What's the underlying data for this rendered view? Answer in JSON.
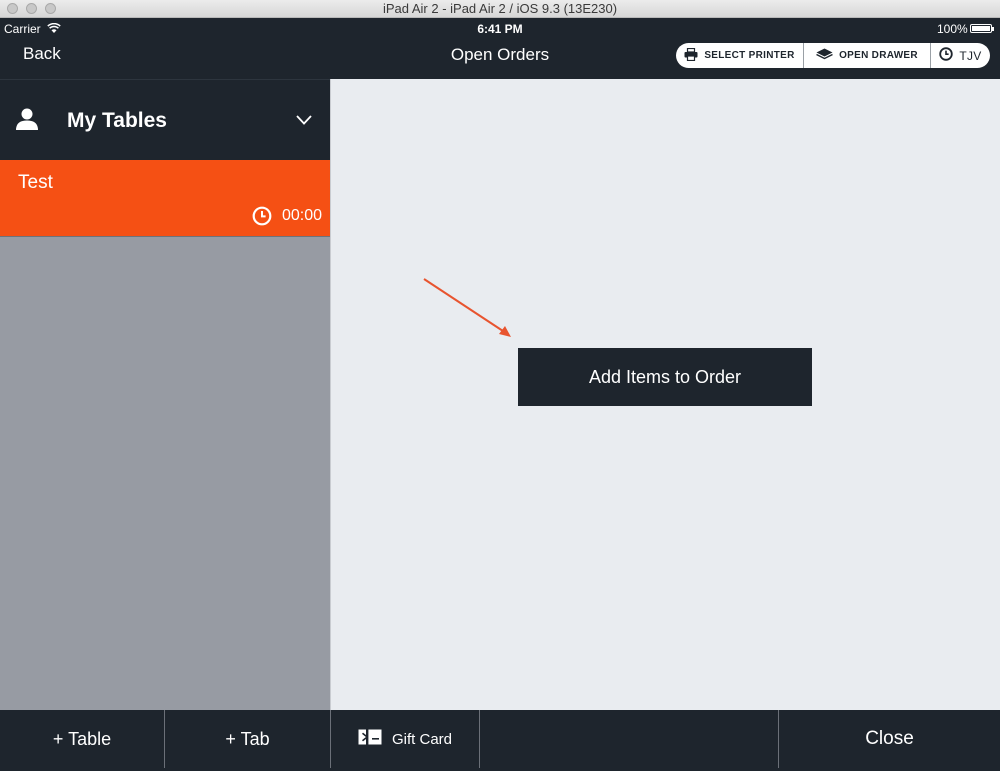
{
  "window": {
    "title": "iPad Air 2 - iPad Air 2 / iOS 9.3 (13E230)"
  },
  "status_bar": {
    "carrier": "Carrier",
    "time": "6:41 PM",
    "battery": "100%"
  },
  "nav": {
    "back_label": "Back",
    "title": "Open Orders",
    "actions": [
      {
        "label": "SELECT PRINTER",
        "icon": "printer-icon"
      },
      {
        "label": "OPEN DRAWER",
        "icon": "drawer-icon"
      },
      {
        "label": "TJV",
        "icon": "clock-icon"
      }
    ]
  },
  "sidebar": {
    "header_label": "My Tables",
    "tables": [
      {
        "name": "Test",
        "timer": "00:00"
      }
    ]
  },
  "main": {
    "add_items_label": "Add Items to Order"
  },
  "toolbar": {
    "add_table_label": "+ Table",
    "add_tab_label": "+ Tab",
    "gift_card_label": "Gift Card",
    "close_label": "Close"
  },
  "colors": {
    "dark": "#1e252d",
    "accent": "#f55014",
    "panel": "#979ba3",
    "canvas": "#e9ecf0",
    "arrow": "#e8542f"
  }
}
